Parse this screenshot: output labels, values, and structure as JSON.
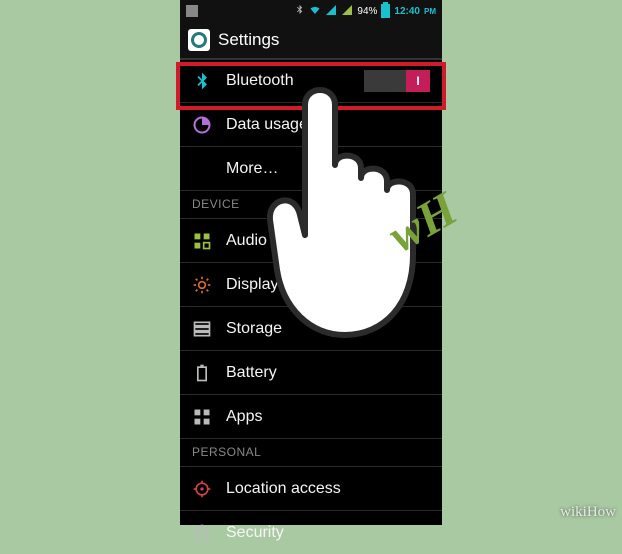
{
  "statusbar": {
    "battery_percent": "94%",
    "time": "12:40",
    "time_suffix": "PM"
  },
  "titlebar": {
    "title": "Settings"
  },
  "highlight_target": "bluetooth-row",
  "rows": {
    "bluetooth": {
      "label": "Bluetooth",
      "toggle_on_text": "I",
      "state": "on"
    },
    "data_usage": {
      "label": "Data usage"
    },
    "more": {
      "label": "More…"
    },
    "audio_profiles": {
      "label": "Audio profiles"
    },
    "display": {
      "label": "Display"
    },
    "storage": {
      "label": "Storage"
    },
    "battery": {
      "label": "Battery"
    },
    "apps": {
      "label": "Apps"
    },
    "location_access": {
      "label": "Location access"
    },
    "security": {
      "label": "Security"
    }
  },
  "sections": {
    "device": "DEVICE",
    "personal": "PERSONAL"
  },
  "overlay": {
    "hand_label": "wH",
    "watermark": "wikiHow"
  },
  "colors": {
    "bg": "#a8c9a1",
    "highlight": "#d11a2a",
    "toggle_on": "#c41e5a",
    "accent_green": "#9cc13f",
    "accent_cyan": "#19c1ce"
  }
}
